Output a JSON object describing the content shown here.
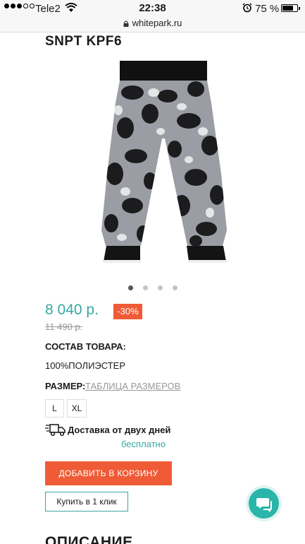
{
  "status_bar": {
    "carrier": "Tele2",
    "time": "22:38",
    "battery": "75 %"
  },
  "browser": {
    "url": "whitepark.ru"
  },
  "product": {
    "title": "SNPT KPF6",
    "price": "8 040 р.",
    "discount": "-30%",
    "old_price": "11 490 р.",
    "composition_label": "СОСТАВ ТОВАРА:",
    "composition_value": "100%ПОЛИЭСТЕР",
    "size_label": "РАЗМЕР:",
    "size_table_link": "ТАБЛИЦА РАЗМЕРОВ",
    "sizes": [
      "L",
      "XL"
    ],
    "delivery_text": "Доставка от двух дней",
    "delivery_price": "бесплатно",
    "add_to_cart": "ДОБАВИТЬ В КОРЗИНУ",
    "buy_one_click": "Купить в 1 клик",
    "description_heading": "ОПИСАНИЕ"
  },
  "colors": {
    "accent": "#37a8a2",
    "cta": "#ef5b36",
    "chat": "#2ab5aa"
  },
  "icons": [
    "wifi-icon",
    "alarm-icon",
    "battery-icon",
    "lock-icon",
    "truck-icon",
    "chat-icon"
  ],
  "carousel": {
    "count": 4,
    "active_index": 0
  }
}
